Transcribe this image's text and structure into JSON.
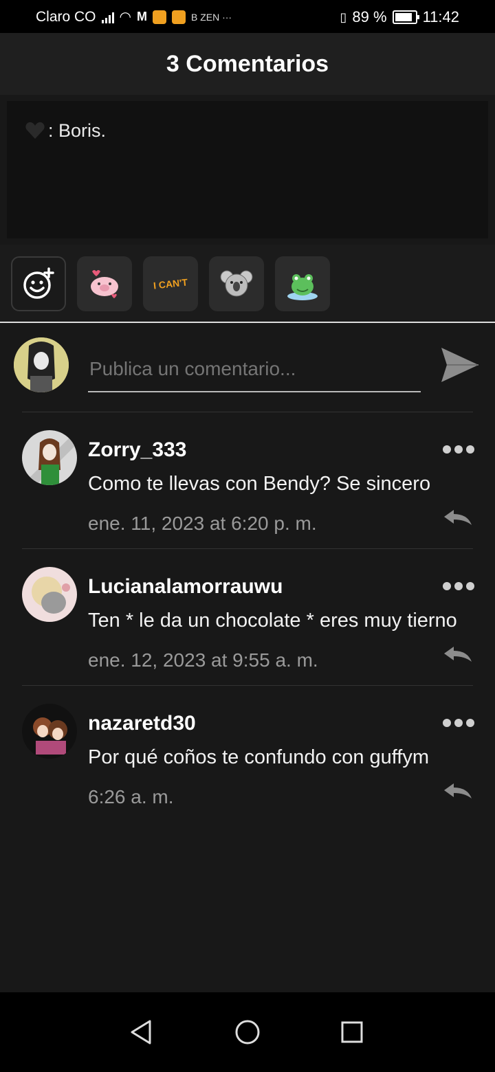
{
  "status_bar": {
    "carrier": "Claro CO",
    "extra": "B  ZEN  ···",
    "battery": "89 %",
    "time": "11:42"
  },
  "header": {
    "title": "3 Comentarios"
  },
  "post": {
    "text": ": Boris."
  },
  "stickers": [
    "emoji-add-icon",
    "pig-sticker",
    "i-cant-sticker",
    "koala-sticker",
    "frog-sticker"
  ],
  "sticker_i_cant_text": "I CAN'T",
  "compose": {
    "placeholder": "Publica un comentario..."
  },
  "comments": [
    {
      "user": "Zorry_333",
      "text": "Como te llevas con Bendy? Se sincero",
      "date": "ene. 11, 2023 at 6:20 p. m."
    },
    {
      "user": "Lucianalamorrauwu",
      "text": "Ten * le da un chocolate * eres muy tierno",
      "date": "ene. 12, 2023 at 9:55 a. m."
    },
    {
      "user": "nazaretd30",
      "text": "Por qué coños te confundo con guffym",
      "date": "6:26 a. m."
    }
  ],
  "colors": {
    "background": "#181818",
    "header": "#1f1f1f",
    "accent_text": "#ffffff",
    "muted_text": "#9a9a9a"
  }
}
